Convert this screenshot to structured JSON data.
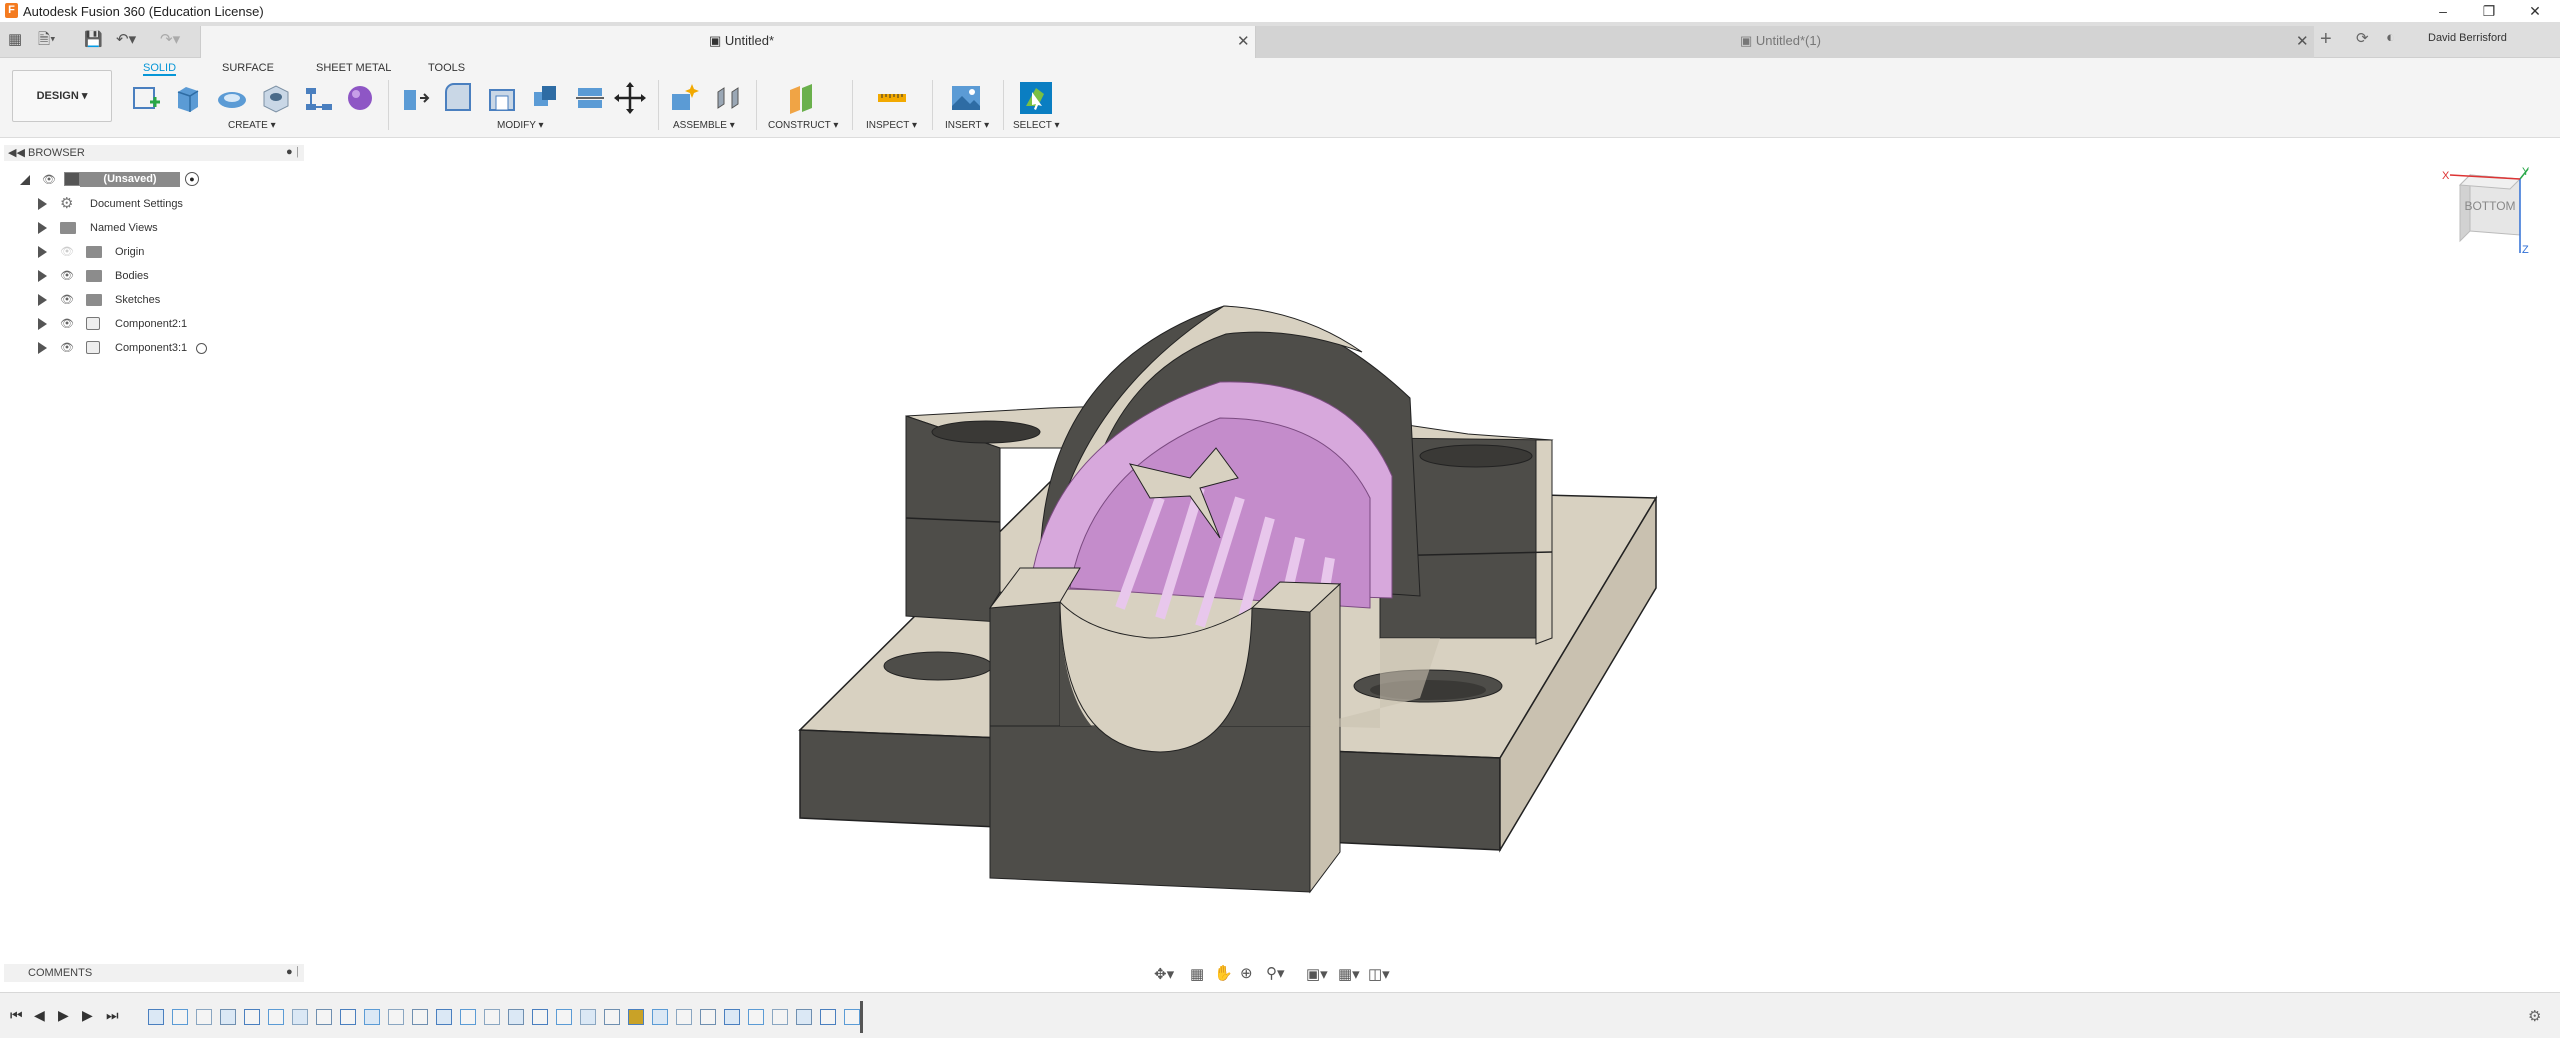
{
  "app": {
    "title": "Autodesk Fusion 360 (Education License)"
  },
  "tabs": [
    {
      "label": "Untitled*",
      "active": true
    },
    {
      "label": "Untitled*(1)",
      "active": false
    }
  ],
  "user": {
    "name": "David Berrisford"
  },
  "workspace": {
    "label": "DESIGN ▾"
  },
  "ribbon": {
    "tabs": [
      "SOLID",
      "SURFACE",
      "SHEET METAL",
      "TOOLS"
    ],
    "active_tab": "SOLID",
    "groups": [
      "CREATE ▾",
      "MODIFY ▾",
      "ASSEMBLE ▾",
      "CONSTRUCT ▾",
      "INSPECT ▾",
      "INSERT ▾",
      "SELECT ▾"
    ]
  },
  "browser": {
    "header": "BROWSER",
    "root": "(Unsaved)",
    "items": [
      {
        "label": "Document Settings",
        "icon": "gear-icon"
      },
      {
        "label": "Named Views",
        "icon": "folder-icon"
      },
      {
        "label": "Origin",
        "icon": "folder-icon"
      },
      {
        "label": "Bodies",
        "icon": "folder-icon"
      },
      {
        "label": "Sketches",
        "icon": "folder-icon"
      },
      {
        "label": "Component2:1",
        "icon": "component-icon"
      },
      {
        "label": "Component3:1",
        "icon": "component-icon"
      }
    ]
  },
  "viewcube": {
    "face": "BOTTOM",
    "axes": {
      "x": "X",
      "y": "Y",
      "z": "Z"
    }
  },
  "comments": {
    "header": "COMMENTS"
  },
  "colors": {
    "accent": "#0696d7",
    "body_light": "#d8d1c1",
    "body_dark": "#4e4d49",
    "bearing": "#d7a8dc",
    "background": "#ffffff"
  }
}
